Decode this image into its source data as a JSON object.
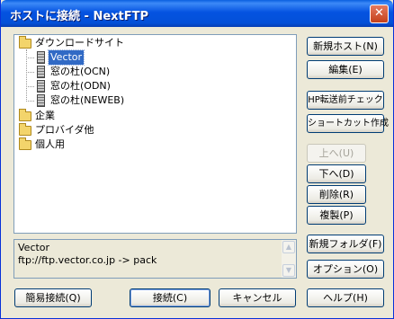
{
  "window": {
    "title": "ホストに接続 - NextFTP"
  },
  "titlebar": {
    "close_glyph": "✕"
  },
  "tree": {
    "items": [
      {
        "label": "ダウンロードサイト"
      },
      {
        "label": "Vector"
      },
      {
        "label": "窓の杜(OCN)"
      },
      {
        "label": "窓の杜(ODN)"
      },
      {
        "label": "窓の杜(NEWEB)"
      },
      {
        "label": "企業"
      },
      {
        "label": "プロバイダ他"
      },
      {
        "label": "個人用"
      }
    ]
  },
  "info": {
    "name": "Vector",
    "detail": "ftp://ftp.vector.co.jp -> pack",
    "scroll_up_glyph": "▲",
    "scroll_down_glyph": "▼"
  },
  "buttons": {
    "new_host": "新規ホスト(N)",
    "edit": "編集(E)",
    "hp_check": "HP転送前チェック",
    "shortcut": "ショートカット作成",
    "up": "上へ(U)",
    "down": "下へ(D)",
    "delete": "削除(R)",
    "copy": "複製(P)",
    "new_folder": "新規フォルダ(F)",
    "options": "オプション(O)",
    "quick_connect": "簡易接続(Q)",
    "connect": "接続(C)",
    "cancel": "キャンセル",
    "help": "ヘルプ(H)"
  }
}
